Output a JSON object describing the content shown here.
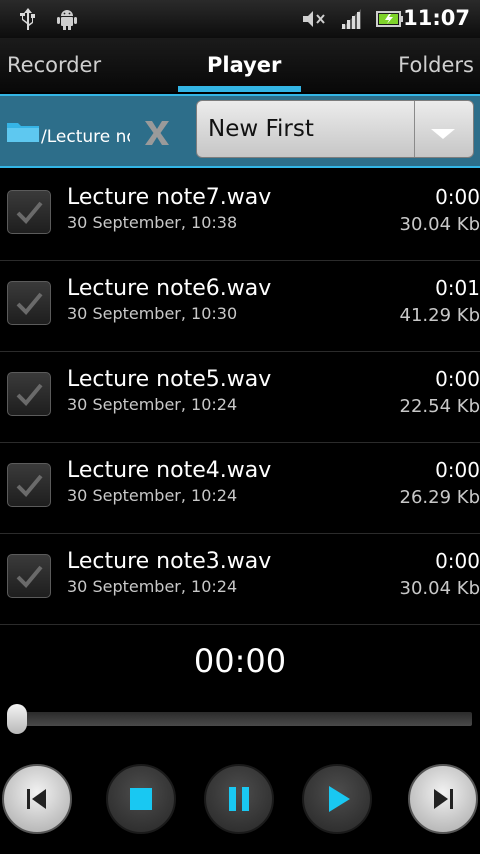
{
  "status_bar": {
    "time": "11:07",
    "icons": [
      "usb-icon",
      "android-debug-icon",
      "mute-icon",
      "signal-icon",
      "battery-charging-icon"
    ]
  },
  "tabs": [
    {
      "label": "Recorder",
      "active": false
    },
    {
      "label": "Player",
      "active": true
    },
    {
      "label": "Folders",
      "active": false
    }
  ],
  "path_bar": {
    "path": "/Lecture no",
    "clear_icon": "x-icon",
    "folder_icon": "folder-icon"
  },
  "sort": {
    "selected": "New First",
    "icon": "chevron-down-icon"
  },
  "files": [
    {
      "name": "Lecture note7.wav",
      "date": "30 September, 10:38",
      "duration": "0:00",
      "size": "30.04 Kb"
    },
    {
      "name": "Lecture note6.wav",
      "date": "30 September, 10:30",
      "duration": "0:01",
      "size": "41.29 Kb"
    },
    {
      "name": "Lecture note5.wav",
      "date": "30 September, 10:24",
      "duration": "0:00",
      "size": "22.54 Kb"
    },
    {
      "name": "Lecture note4.wav",
      "date": "30 September, 10:24",
      "duration": "0:00",
      "size": "26.29 Kb"
    },
    {
      "name": "Lecture note3.wav",
      "date": "30 September, 10:24",
      "duration": "0:00",
      "size": "30.04 Kb"
    }
  ],
  "player": {
    "time": "00:00",
    "progress": 0
  },
  "controls": [
    "previous-icon",
    "stop-icon",
    "pause-icon",
    "play-icon",
    "next-icon"
  ],
  "colors": {
    "accent": "#33b5e5",
    "path_bar": "#2d6e8a",
    "background": "#000000"
  }
}
